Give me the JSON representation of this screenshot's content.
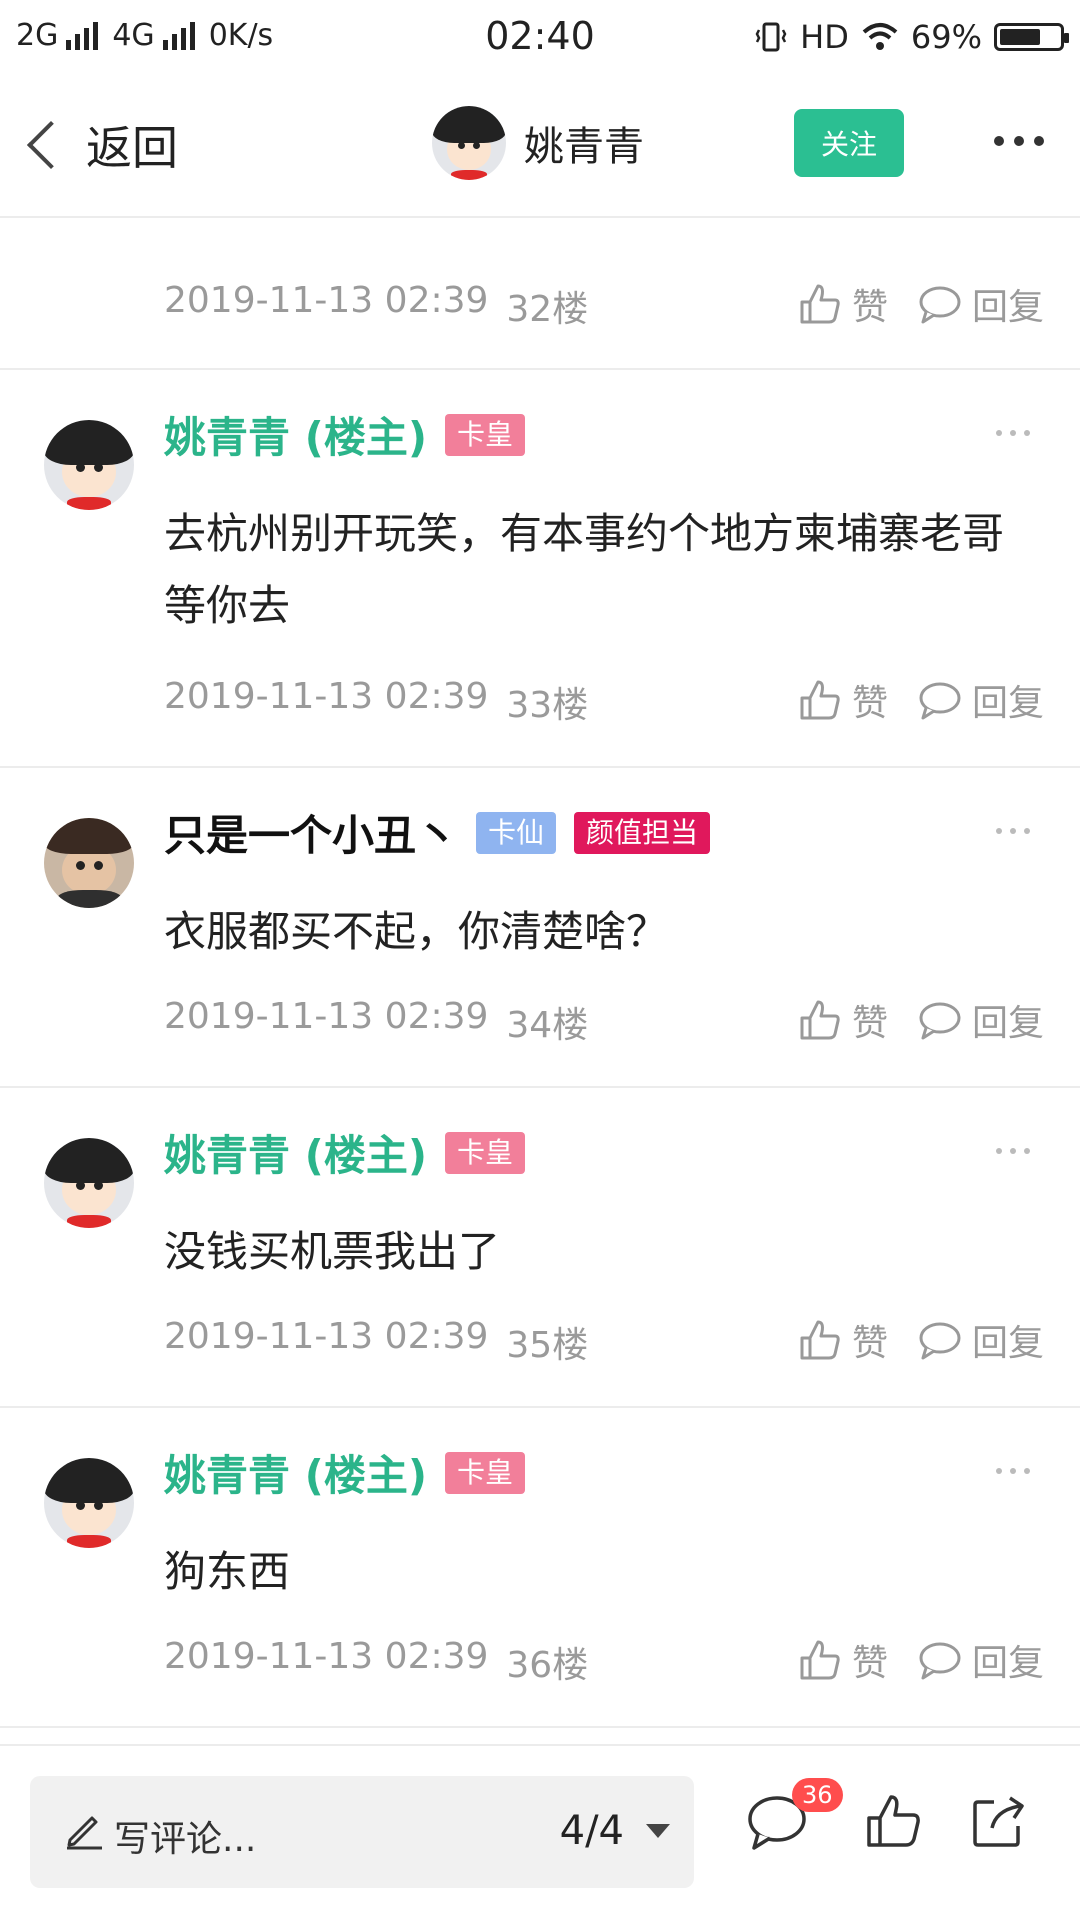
{
  "status_bar": {
    "left": "2G 4G 0K/s",
    "sim1": "2G",
    "sim2": "4G",
    "speed": "0K/s",
    "time": "02:40",
    "hd": "HD",
    "battery": "69%",
    "battery_level": 0.69
  },
  "nav": {
    "back_label": "返回",
    "user_name": "姚青青",
    "follow_label": "关注"
  },
  "posts": [
    {
      "time": "2019-11-13 02:39",
      "floor": "32楼",
      "like": "赞",
      "reply": "回复"
    },
    {
      "name": "姚青青 (楼主)",
      "badge": "卡皇",
      "badge_color": "#f27f9a",
      "content": "去杭州别开玩笑，有本事约个地方柬埔寨老哥等你去",
      "time": "2019-11-13 02:39",
      "floor": "33楼",
      "like": "赞",
      "reply": "回复"
    },
    {
      "name": "只是一个小丑丶",
      "badge": "卡仙",
      "badge_color": "#8fb4f0",
      "badge2": "颜值担当",
      "badge2_color": "#e0185c",
      "content": "衣服都买不起，你清楚啥？",
      "time": "2019-11-13 02:39",
      "floor": "34楼",
      "like": "赞",
      "reply": "回复"
    },
    {
      "name": "姚青青 (楼主)",
      "badge": "卡皇",
      "badge_color": "#f27f9a",
      "content": "没钱买机票我出了",
      "time": "2019-11-13 02:39",
      "floor": "35楼",
      "like": "赞",
      "reply": "回复"
    },
    {
      "name": "姚青青 (楼主)",
      "badge": "卡皇",
      "badge_color": "#f27f9a",
      "content": "狗东西",
      "time": "2019-11-13 02:39",
      "floor": "36楼",
      "like": "赞",
      "reply": "回复"
    }
  ],
  "bottom": {
    "comment_placeholder": "写评论...",
    "page": "4/4",
    "comment_count": "36"
  },
  "colors": {
    "accent": "#2bbf92",
    "name_green": "#2bb48a"
  }
}
